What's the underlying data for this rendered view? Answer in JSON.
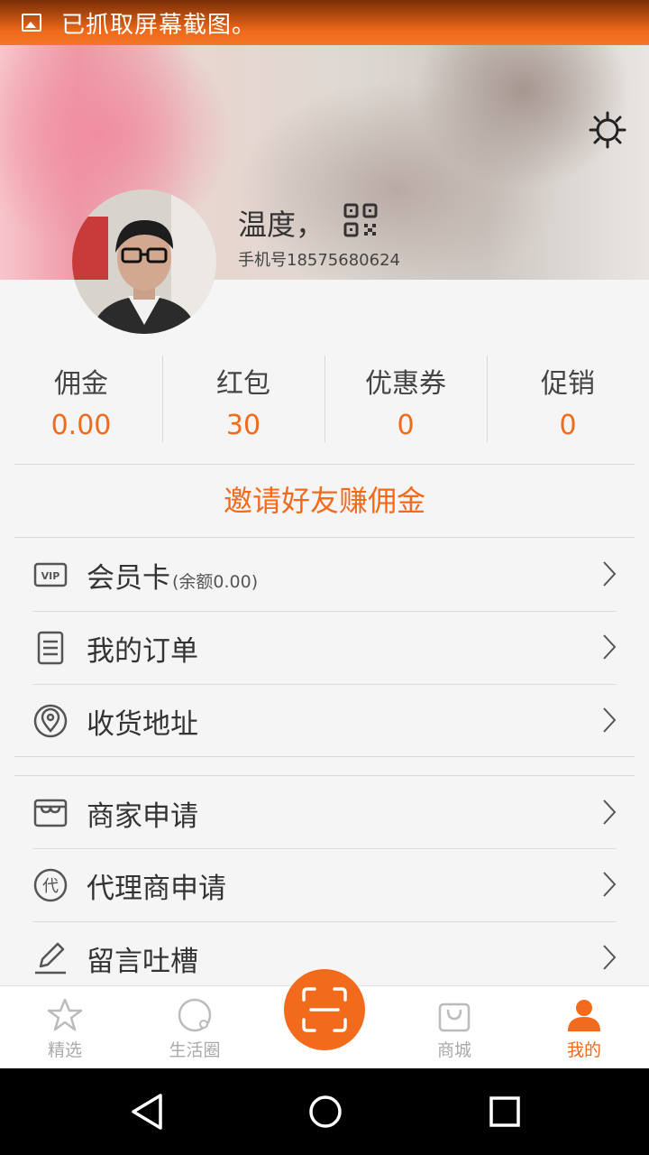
{
  "status_bar": {
    "text": "已抓取屏幕截图。",
    "icon": "image-icon"
  },
  "profile": {
    "name": "温度，",
    "phone": "手机号18575680624",
    "settings_icon": "gear-icon",
    "qr_icon": "qr-code-icon"
  },
  "stats": [
    {
      "label": "佣金",
      "value": "0.00"
    },
    {
      "label": "红包",
      "value": "30"
    },
    {
      "label": "优惠券",
      "value": "0"
    },
    {
      "label": "促销",
      "value": "0"
    }
  ],
  "invite": {
    "label": "邀请好友赚佣金"
  },
  "menu_group1": [
    {
      "label": "会员卡",
      "sub": "(余额0.00)",
      "icon": "vip-card-icon"
    },
    {
      "label": "我的订单",
      "sub": "",
      "icon": "order-list-icon"
    },
    {
      "label": "收货地址",
      "sub": "",
      "icon": "location-pin-icon"
    }
  ],
  "menu_group2": [
    {
      "label": "商家申请",
      "icon": "store-icon"
    },
    {
      "label": "代理商申请",
      "icon": "agent-icon"
    },
    {
      "label": "留言吐槽",
      "icon": "pencil-icon"
    }
  ],
  "tabs": [
    {
      "label": "精选",
      "icon": "star-icon",
      "active": false
    },
    {
      "label": "生活圈",
      "icon": "circle-icon",
      "active": false
    },
    {
      "label": "商城",
      "icon": "shopping-bag-icon",
      "active": false
    },
    {
      "label": "我的",
      "icon": "user-icon",
      "active": true
    }
  ],
  "colors": {
    "accent": "#f26a1b",
    "status_bar": "#f06a1a"
  }
}
